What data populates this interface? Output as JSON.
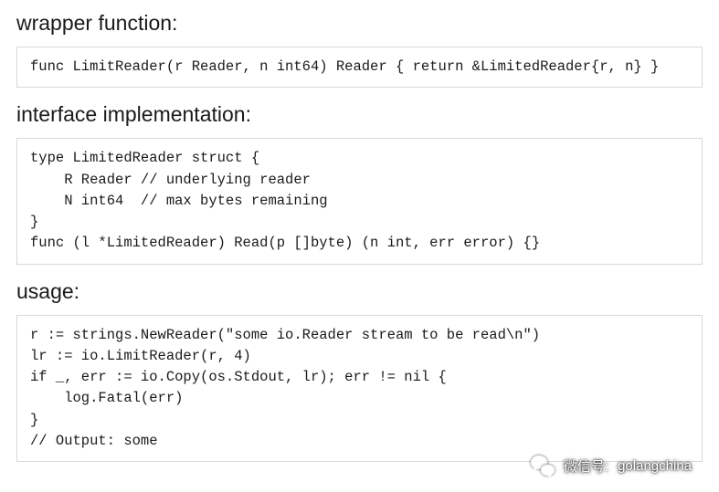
{
  "sections": {
    "wrapper": {
      "heading": "wrapper function:",
      "code": "func LimitReader(r Reader, n int64) Reader { return &LimitedReader{r, n} }"
    },
    "interface": {
      "heading": "interface implementation:",
      "code": "type LimitedReader struct {\n    R Reader // underlying reader\n    N int64  // max bytes remaining\n}\nfunc (l *LimitedReader) Read(p []byte) (n int, err error) {}"
    },
    "usage": {
      "heading": "usage:",
      "code": "r := strings.NewReader(\"some io.Reader stream to be read\\n\")\nlr := io.LimitReader(r, 4)\nif _, err := io.Copy(os.Stdout, lr); err != nil {\n    log.Fatal(err)\n}\n// Output: some"
    }
  },
  "watermark": {
    "label": "微信号:",
    "account": "golangchina"
  }
}
